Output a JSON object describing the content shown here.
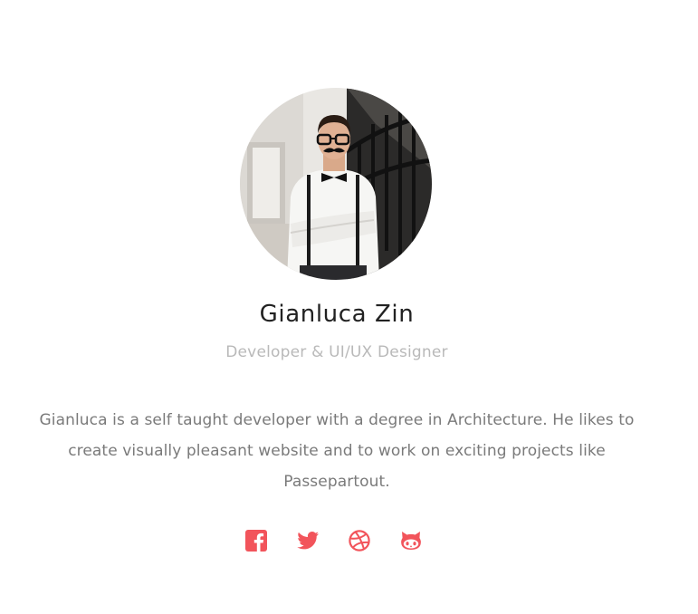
{
  "profile": {
    "name": "Gianluca Zin",
    "role": "Developer & UI/UX Designer",
    "bio": "Gianluca is a self taught developer with a degree in Architecture. He likes to create visually pleasant website and to work on exciting projects like Passepartout."
  },
  "socials": [
    {
      "icon": "facebook-icon"
    },
    {
      "icon": "twitter-icon"
    },
    {
      "icon": "dribbble-icon"
    },
    {
      "icon": "github-icon"
    }
  ],
  "colors": {
    "accent": "#f2545b",
    "name": "#222222",
    "role": "#b9b9b9",
    "bio": "#7a7a7a"
  }
}
